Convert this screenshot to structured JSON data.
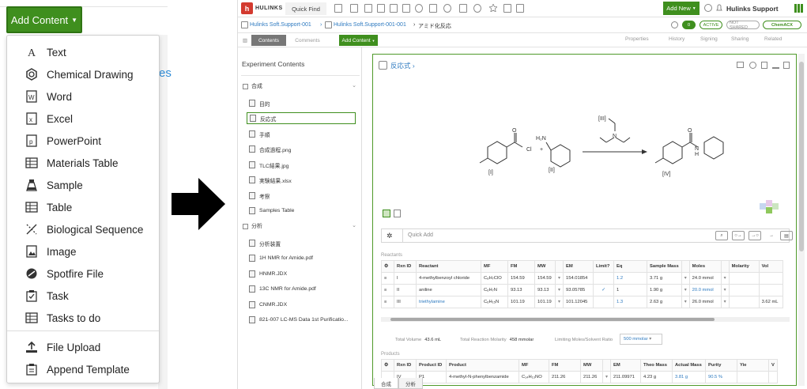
{
  "left": {
    "add_button_label": "Add Content",
    "ghost_text": "es",
    "menu_items": [
      {
        "label": "Text",
        "icon": "text-icon"
      },
      {
        "label": "Chemical Drawing",
        "icon": "chemical-drawing-icon"
      },
      {
        "label": "Word",
        "icon": "word-icon"
      },
      {
        "label": "Excel",
        "icon": "excel-icon"
      },
      {
        "label": "PowerPoint",
        "icon": "powerpoint-icon"
      },
      {
        "label": "Materials Table",
        "icon": "materials-table-icon"
      },
      {
        "label": "Sample",
        "icon": "sample-icon"
      },
      {
        "label": "Table",
        "icon": "table-icon"
      },
      {
        "label": "Biological Sequence",
        "icon": "biological-sequence-icon"
      },
      {
        "label": "Image",
        "icon": "image-icon"
      },
      {
        "label": "Spotfire File",
        "icon": "spotfire-icon"
      },
      {
        "label": "Task",
        "icon": "task-icon"
      },
      {
        "label": "Tasks to do",
        "icon": "tasks-todo-icon"
      }
    ],
    "menu_items_bottom": [
      {
        "label": "File Upload",
        "icon": "upload-icon"
      },
      {
        "label": "Append Template",
        "icon": "append-template-icon"
      }
    ]
  },
  "app": {
    "brand": "HULINKS",
    "quick_find": "Quick Find",
    "new_button": "Add New",
    "user": "Hulinks Support",
    "breadcrumbs": [
      "Hulinks Soft.Support-001",
      "Hulinks Soft.Support-001-001",
      "アミド化反応"
    ],
    "badge_count": "0",
    "status_active": "ACTIVE",
    "status_shared": "NOT SHARED",
    "chemacx": "ChemACX",
    "tabs": {
      "contents": "Contents",
      "comments": "Comments",
      "add_content": "Add Content"
    },
    "toolbar_right": [
      "Properties",
      "History",
      "Signing",
      "Sharing",
      "Related"
    ],
    "sidebar": {
      "title": "Experiment Contents",
      "section1": "合成",
      "items1": [
        "目的",
        "反応式",
        "手順",
        "合成過程.png",
        "TLC結果.jpg",
        "実験結果.xlsx",
        "考察",
        "Samples Table"
      ],
      "section2": "分析",
      "items2": [
        "分析装置",
        "1H NMR for Amide.pdf",
        "HNMR.JDX",
        "13C NMR for Amide.pdf",
        "CNMR.JDX",
        "821-007 LC-MS Data 1st Purificatio..."
      ]
    },
    "reaction": {
      "title": "反応式",
      "labels": {
        "r1": "[I]",
        "r2": "[II]",
        "reagent": "[III]",
        "product": "[IV]",
        "cl": "Cl",
        "o": "O",
        "h2n": "H₂N",
        "n": "N",
        "h": "H",
        "plus": "+"
      }
    },
    "quick_add_placeholder": "Quick Add",
    "reactants_label": "Reactants",
    "reactants_headers": [
      "",
      "Rxn ID",
      "Reactant",
      "MF",
      "FM",
      "MW",
      "",
      "EM",
      "Limit?",
      "Eq",
      "Sample Mass",
      "",
      "Moles",
      "",
      "Molarity",
      "Vol"
    ],
    "reactants_rows": [
      [
        "≡",
        "I",
        "4-methylbenzoyl chloride",
        "C₈H₇ClO",
        "154.59",
        "154.59",
        "▾",
        "154.01854",
        "",
        "1.2",
        "3.71 g",
        "▾",
        "24.0 mmol",
        "▾",
        "",
        ""
      ],
      [
        "≡",
        "II",
        "aniline",
        "C₆H₇N",
        "93.13",
        "93.13",
        "▾",
        "93.05785",
        "✓",
        "1",
        "1.90 g",
        "▾",
        "20.0 mmol",
        "▾",
        "",
        ""
      ],
      [
        "≡",
        "III",
        "triethylamine",
        "C₆H₁₅N",
        "101.19",
        "101.19",
        "▾",
        "101.12045",
        "",
        "1.3",
        "2.63 g",
        "▾",
        "26.0 mmol",
        "▾",
        "",
        "3.62 mL"
      ]
    ],
    "totals": {
      "volume_label": "Total Volume",
      "volume": "43.6 mL",
      "molarity_label": "Total Reaction Molarity",
      "molarity": "458 mmolar",
      "limiting_label": "Limiting Moles/Solvent Ratio",
      "limiting": "500 mmolar"
    },
    "products_label": "Products",
    "products_headers": [
      "",
      "Rxn ID",
      "Product ID",
      "Product",
      "MF",
      "FM",
      "MW",
      "",
      "EM",
      "Theo Mass",
      "Actual Mass",
      "Purity",
      "Yie",
      "V"
    ],
    "products_row": [
      "",
      "IV",
      "P1",
      "4-methyl-N-phenylbenzamide",
      "C₁₄H₁₃NO",
      "211.26",
      "211.26",
      "▾",
      "211.09971",
      "4.23 g",
      "3.81 g",
      "90.5 %",
      "",
      ""
    ],
    "bottom_tabs": [
      "合成",
      "分析"
    ],
    "colors": {
      "accent": "#3f8f1e",
      "link": "#2e7ac0",
      "brand": "#d33a2f"
    }
  }
}
